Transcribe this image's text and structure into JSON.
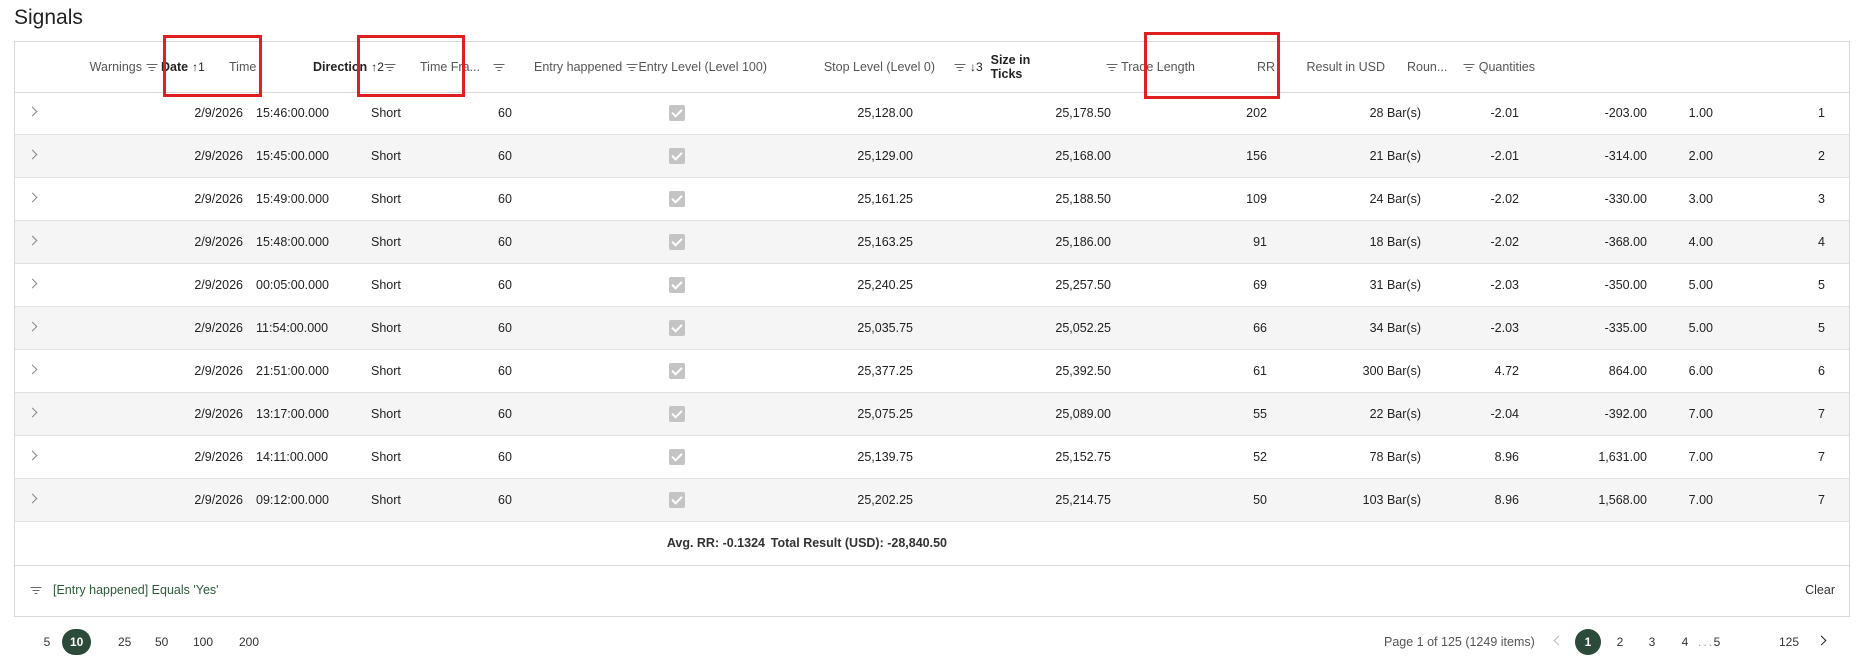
{
  "title": "Signals",
  "columns": {
    "warnings": "Warnings",
    "date": "Date",
    "date_sort": "↑1",
    "time": "Time",
    "direction": "Direction",
    "direction_sort": "↑2",
    "time_frame": "Time Fra...",
    "entry_happened": "Entry happened",
    "entry_level": "Entry Level (Level 100)",
    "stop_level": "Stop Level (Level 0)",
    "size_sort": "↓3",
    "size_in_ticks": "Size in Ticks",
    "trade_length": "Trade Length",
    "rr": "RR",
    "result_usd": "Result in USD",
    "round": "Roun...",
    "quantities": "Quantities"
  },
  "rows": [
    {
      "date": "2/9/2026",
      "time": "15:46:00.000",
      "direction": "Short",
      "tf": "60",
      "entry": "25,128.00",
      "stop": "25,178.50",
      "ticks": "202",
      "length": "28 Bar(s)",
      "rr": "-2.01",
      "result": "-203.00",
      "round": "1.00",
      "qty": "1"
    },
    {
      "date": "2/9/2026",
      "time": "15:45:00.000",
      "direction": "Short",
      "tf": "60",
      "entry": "25,129.00",
      "stop": "25,168.00",
      "ticks": "156",
      "length": "21 Bar(s)",
      "rr": "-2.01",
      "result": "-314.00",
      "round": "2.00",
      "qty": "2"
    },
    {
      "date": "2/9/2026",
      "time": "15:49:00.000",
      "direction": "Short",
      "tf": "60",
      "entry": "25,161.25",
      "stop": "25,188.50",
      "ticks": "109",
      "length": "24 Bar(s)",
      "rr": "-2.02",
      "result": "-330.00",
      "round": "3.00",
      "qty": "3"
    },
    {
      "date": "2/9/2026",
      "time": "15:48:00.000",
      "direction": "Short",
      "tf": "60",
      "entry": "25,163.25",
      "stop": "25,186.00",
      "ticks": "91",
      "length": "18 Bar(s)",
      "rr": "-2.02",
      "result": "-368.00",
      "round": "4.00",
      "qty": "4"
    },
    {
      "date": "2/9/2026",
      "time": "00:05:00.000",
      "direction": "Short",
      "tf": "60",
      "entry": "25,240.25",
      "stop": "25,257.50",
      "ticks": "69",
      "length": "31 Bar(s)",
      "rr": "-2.03",
      "result": "-350.00",
      "round": "5.00",
      "qty": "5"
    },
    {
      "date": "2/9/2026",
      "time": "11:54:00.000",
      "direction": "Short",
      "tf": "60",
      "entry": "25,035.75",
      "stop": "25,052.25",
      "ticks": "66",
      "length": "34 Bar(s)",
      "rr": "-2.03",
      "result": "-335.00",
      "round": "5.00",
      "qty": "5"
    },
    {
      "date": "2/9/2026",
      "time": "21:51:00.000",
      "direction": "Short",
      "tf": "60",
      "entry": "25,377.25",
      "stop": "25,392.50",
      "ticks": "61",
      "length": "300 Bar(s)",
      "rr": "4.72",
      "result": "864.00",
      "round": "6.00",
      "qty": "6"
    },
    {
      "date": "2/9/2026",
      "time": "13:17:00.000",
      "direction": "Short",
      "tf": "60",
      "entry": "25,075.25",
      "stop": "25,089.00",
      "ticks": "55",
      "length": "22 Bar(s)",
      "rr": "-2.04",
      "result": "-392.00",
      "round": "7.00",
      "qty": "7"
    },
    {
      "date": "2/9/2026",
      "time": "14:11:00.000",
      "direction": "Short",
      "tf": "60",
      "entry": "25,139.75",
      "stop": "25,152.75",
      "ticks": "52",
      "length": "78 Bar(s)",
      "rr": "8.96",
      "result": "1,631.00",
      "round": "7.00",
      "qty": "7"
    },
    {
      "date": "2/9/2026",
      "time": "09:12:00.000",
      "direction": "Short",
      "tf": "60",
      "entry": "25,202.25",
      "stop": "25,214.75",
      "ticks": "50",
      "length": "103 Bar(s)",
      "rr": "8.96",
      "result": "1,568.00",
      "round": "7.00",
      "qty": "7"
    }
  ],
  "summary": {
    "avg_rr": "Avg. RR: -0.1324",
    "total_result": "Total Result (USD): -28,840.50"
  },
  "filter": {
    "text": "[Entry happened] Equals 'Yes'",
    "clear_label": "Clear"
  },
  "pager": {
    "page_sizes": [
      "5",
      "10",
      "25",
      "50",
      "100",
      "200"
    ],
    "active_page_size": "10",
    "info": "Page 1 of 125 (1249 items)",
    "pages": [
      "1",
      "2",
      "3",
      "4",
      "5"
    ],
    "ellipsis": "...",
    "last_page": "125",
    "active_page": "1"
  },
  "colors": {
    "accent": "#2c4a3a",
    "highlight": "#e02020",
    "alt_row": "#f5f5f5"
  }
}
